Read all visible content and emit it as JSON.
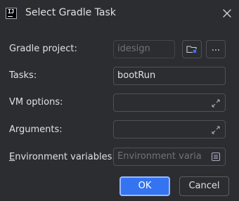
{
  "window": {
    "title": "Select Gradle Task"
  },
  "form": {
    "project_label": "Gradle project:",
    "project_value": "idesign",
    "tasks_label": "Tasks:",
    "tasks_value": "bootRun",
    "vm_options_label": "VM options:",
    "vm_options_value": "",
    "arguments_label": "Arguments:",
    "arguments_value": "",
    "env_label_mnemonic": "E",
    "env_label_rest": "nvironment variables:",
    "env_placeholder": "Environment variables"
  },
  "buttons": {
    "ok": "OK",
    "cancel": "Cancel",
    "more": "..."
  },
  "icons": {
    "app": "intellij-idea-icon",
    "close": "close-icon",
    "folder": "folder-icon",
    "expand": "expand-icon",
    "edit": "edit-list-icon"
  },
  "colors": {
    "background": "#2b2d30",
    "accent": "#3574f0",
    "text": "#dfe1e5",
    "placeholder": "#6f737a"
  }
}
